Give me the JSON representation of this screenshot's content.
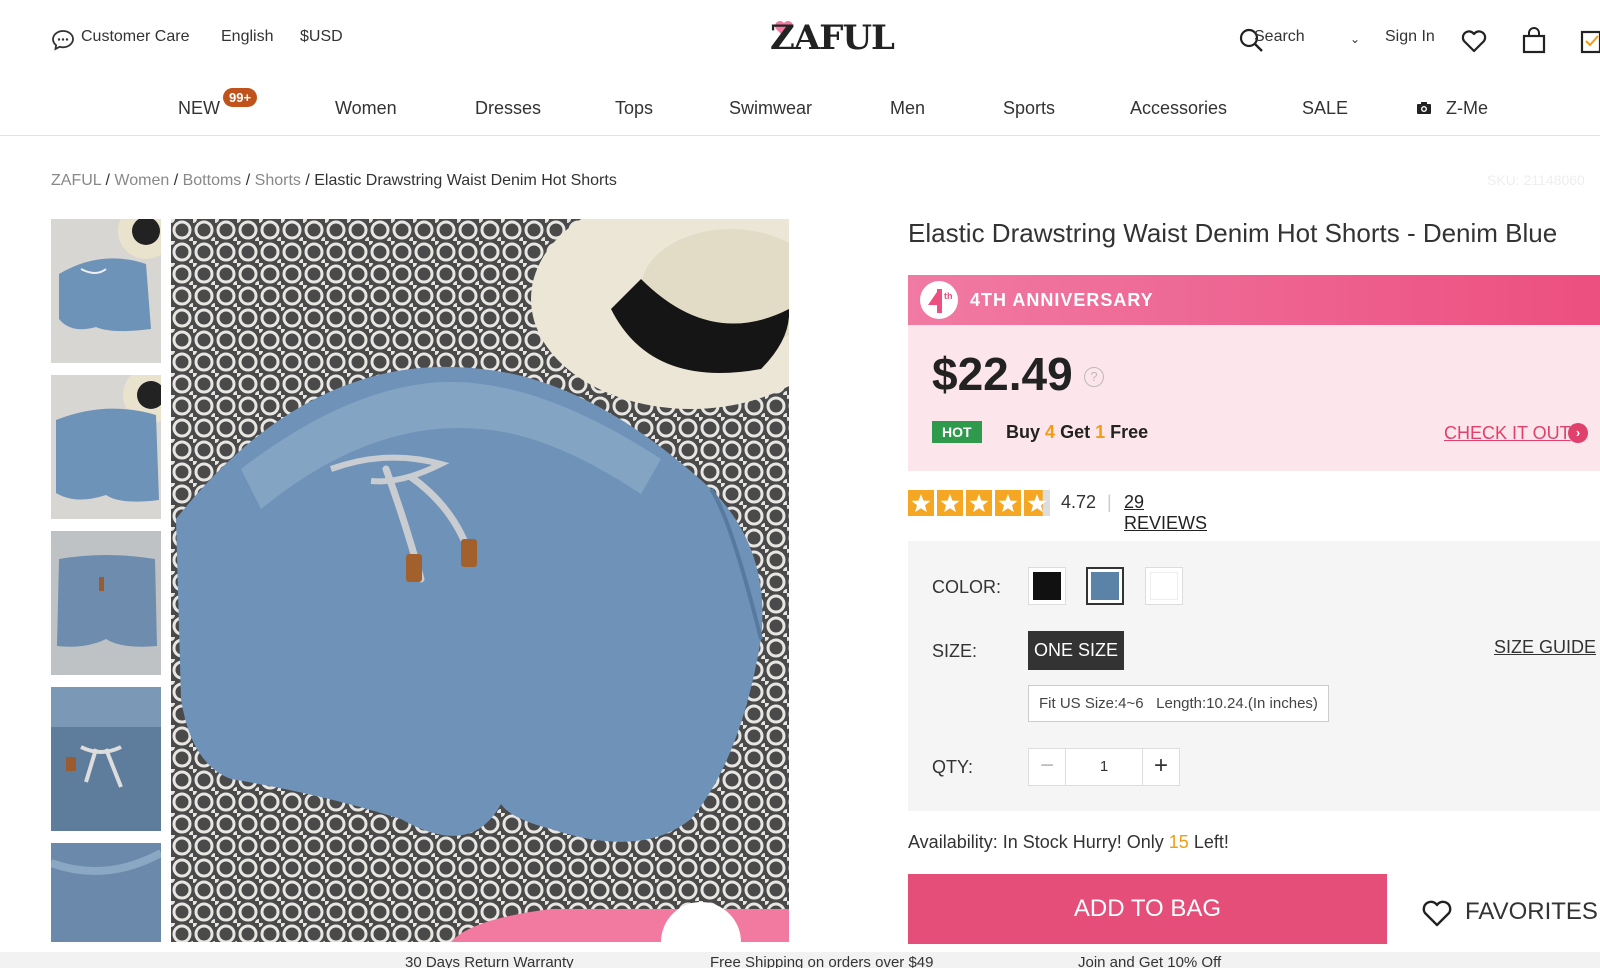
{
  "topbar": {
    "customer_care": "Customer Care",
    "language": "English",
    "currency": "$USD",
    "logo": "ZAFUL",
    "search_label": "Search",
    "sign_in": "Sign In"
  },
  "nav": {
    "new_label": "NEW",
    "new_badge": "99+",
    "items": [
      "Women",
      "Dresses",
      "Tops",
      "Swimwear",
      "Men",
      "Sports",
      "Accessories",
      "SALE",
      "Z-Me"
    ]
  },
  "breadcrumb": {
    "items": [
      "ZAFUL",
      "Women",
      "Bottoms",
      "Shorts"
    ],
    "current": "Elastic Drawstring Waist Denim Hot Shorts",
    "sku": "SKU: 21148060"
  },
  "product": {
    "title": "Elastic Drawstring Waist Denim Hot Shorts - Denim Blue",
    "banner": "4TH ANNIVERSARY",
    "price": "$22.49",
    "hot_badge": "HOT",
    "promo_buy": "Buy",
    "promo_buy_num": "4",
    "promo_get": "Get",
    "promo_get_num": "1",
    "promo_free": "Free",
    "check_it_out": "CHECK IT OUT",
    "rating": "4.72",
    "rating_stars": 4.72,
    "reviews": "29 REVIEWS",
    "color_label": "COLOR:",
    "size_label": "SIZE:",
    "size_value": "ONE SIZE",
    "size_guide": "SIZE GUIDE",
    "fit_info": "Fit US Size:4~6   Length:10.24.(In inches)",
    "qty_label": "QTY:",
    "qty_value": "1",
    "availability_prefix": "Availability: In Stock Hurry! Only",
    "availability_count": "15",
    "availability_suffix": "Left!",
    "add_to_bag": "ADD TO BAG",
    "favorites": "FAVORITES"
  },
  "colors": {
    "accent": "#e54e78",
    "hot": "#2f9a4c",
    "star": "#f5a623",
    "swatches": [
      "#111111",
      "#5b83a8",
      "#ffffff"
    ]
  },
  "bottom_strip": {
    "items": [
      "30 Days Return Warranty",
      "Free Shipping on orders over $49",
      "Join and Get 10% Off"
    ]
  }
}
